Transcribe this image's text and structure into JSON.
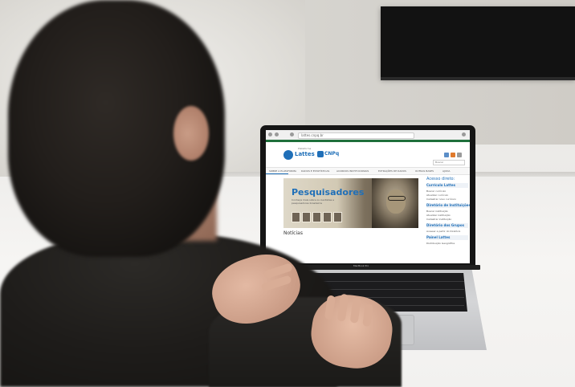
{
  "scene": {
    "description_colors": {
      "wall": "#dedcd7",
      "desk": "#f2f1ef",
      "monitor": "#121212",
      "shirt": "#1e1c1a",
      "skin": "#d9ad96"
    }
  },
  "laptop": {
    "model_label": "MacBook Pro",
    "browser": {
      "url": "lattes.cnpq.br"
    },
    "site": {
      "brand_small": "Plataforma",
      "brand": "Lattes",
      "partner": "CNPq",
      "search_placeholder": "Buscar",
      "nav": [
        "SOBRE A PLATAFORMA",
        "DADOS E ESTATÍSTICAS",
        "ACORDOS INSTITUCIONAIS",
        "EXTRAÇÕES DE DADOS",
        "OUTRAS BASES",
        "AJUDA"
      ],
      "banner": {
        "title": "Pesquisadores",
        "subtitle": "Conheça mais sobre os cientistas e pesquisadores brasileiros"
      },
      "news_label": "Notícias",
      "sidebar": {
        "title": "Acesso direto:",
        "sections": [
          {
            "head": "Currículo Lattes",
            "items": [
              "Buscar currículo",
              "Atualizar currículo",
              "Cadastrar novo currículo"
            ]
          },
          {
            "head": "Diretório de Instituições",
            "items": [
              "Buscar instituição",
              "Atualizar instituição",
              "Cadastrar instituição"
            ]
          },
          {
            "head": "Diretório dos Grupos",
            "items": [
              "Acessar a partir do Diretório"
            ]
          },
          {
            "head": "Painel Lattes",
            "items": [
              "Distribuição Geográfica"
            ]
          }
        ]
      }
    }
  }
}
